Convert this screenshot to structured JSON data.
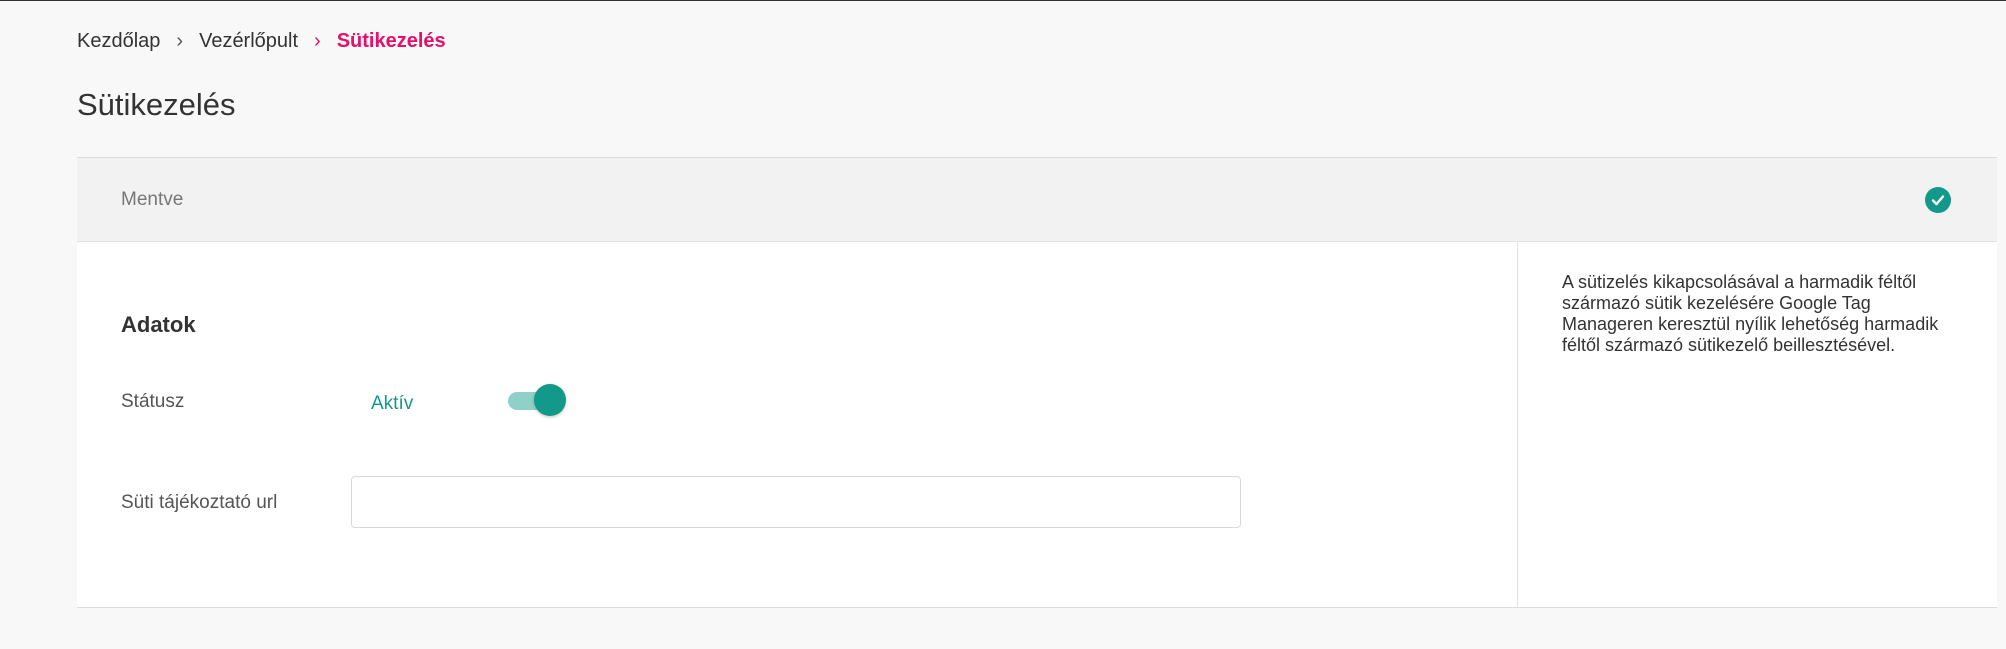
{
  "breadcrumb": {
    "items": [
      "Kezdőlap",
      "Vezérlőpult"
    ],
    "current": "Sütikezelés"
  },
  "page": {
    "title": "Sütikezelés"
  },
  "saved_bar": {
    "label": "Mentve",
    "icon": "check-circle-icon"
  },
  "form": {
    "section_title": "Adatok",
    "status_label": "Státusz",
    "status_value": "Aktív",
    "status_on": true,
    "url_label": "Süti tájékoztató url",
    "url_value": ""
  },
  "help": {
    "text": "A sütizelés kikapcsolásával a harmadik féltől származó sütik kezelésére Google Tag Manageren keresztül nyílik lehetőség harmadik féltől származó sütikezelő beillesztésével."
  },
  "colors": {
    "accent": "#e5106a",
    "teal": "#12998a",
    "teal_light": "#8fd1c8"
  }
}
